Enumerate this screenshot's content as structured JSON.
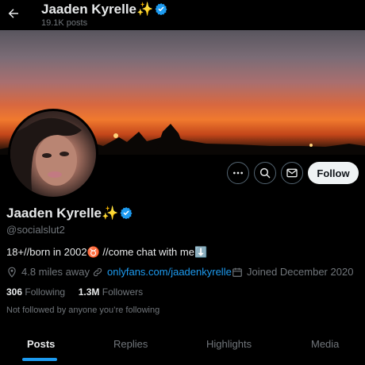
{
  "header": {
    "name": "Jaaden Kyrelle",
    "sparkle": "✨",
    "posts": "19.1K posts"
  },
  "profile": {
    "name": "Jaaden Kyrelle",
    "sparkle": "✨",
    "handle": "@socialslut2",
    "bio_part1": "18+//born in 2002",
    "bio_emoji1": "♉",
    "bio_part2": " //come chat with me",
    "bio_emoji2": "⬇️",
    "location": "4.8 miles away",
    "link": "onlyfans.com/jaadenkyrelle",
    "joined": "Joined December 2020",
    "following_count": "306",
    "following_label": "Following",
    "followers_count": "1.3M",
    "followers_label": "Followers",
    "followed_by": "Not followed by anyone you’re following"
  },
  "actions": {
    "follow": "Follow"
  },
  "tabs": [
    {
      "label": "Posts"
    },
    {
      "label": "Replies"
    },
    {
      "label": "Highlights"
    },
    {
      "label": "Media"
    }
  ],
  "colors": {
    "accent": "#1d9bf0",
    "verified": "#1d9bf0"
  }
}
